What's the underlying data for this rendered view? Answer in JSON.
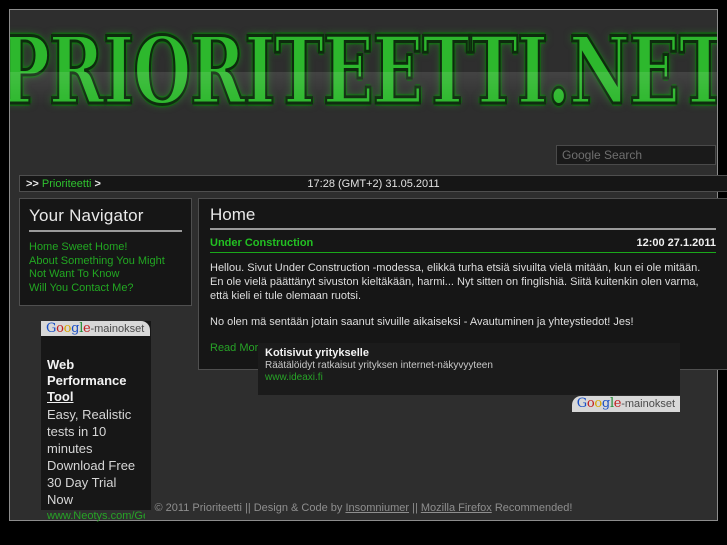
{
  "site": {
    "logo_text": "PRIORITEETTI.NET",
    "accent_green": "#22c022",
    "link_green": "#27a327",
    "background": "#2e2e2e",
    "panel_background": "#161616"
  },
  "search": {
    "placeholder": "Google Search",
    "value": ""
  },
  "breadcrumb": {
    "prefix": ">>",
    "link": "Prioriteetti",
    "suffix": ">"
  },
  "clock": {
    "text": "17:28 (GMT+2) 31.05.2011"
  },
  "sidebar": {
    "title": "Your Navigator",
    "items": [
      {
        "label": "Home Sweet Home!"
      },
      {
        "label": "About Something You Might Not Want To Know"
      },
      {
        "label": "Will You Contact Me?"
      }
    ],
    "ad": {
      "tag_brand": "Google",
      "tag_suffix": "-mainokset",
      "title_line1": "Web Performance",
      "title_line2": "Tool",
      "description": "Easy, Realistic tests in 10 minutes Download Free 30 Day Trial Now",
      "url": "www.Neotys.com/Get..."
    }
  },
  "main": {
    "page_title": "Home",
    "post": {
      "title": "Under Construction",
      "date": "12:00 27.1.2011",
      "paragraph1": "Hellou. Sivut Under Construction -modessa, elikkä turha etsiä sivuilta vielä mitään, kun ei ole mitään. En ole vielä päättänyt sivuston kieltäkään, harmi... Nyt sitten on finglishiä. Siitä kuitenkin olen varma, että kieli ei tule olemaan ruotsi.",
      "paragraph2": "No olen mä sentään jotain saanut sivuille aikaiseksi - Avautuminen ja yhteystiedot! Jes!",
      "read_more": "Read More... Oh, Ya can't. HaHa!"
    },
    "ad": {
      "title": "Kotisivut yritykselle",
      "description": "Räätälöidyt ratkaisut yrityksen internet-näkyvyyteen",
      "url": "www.ideaxi.fi",
      "tag_brand": "Google",
      "tag_suffix": "-mainokset"
    }
  },
  "footer": {
    "copyright": "© 2011 Prioriteetti || Design & Code by ",
    "author_link": "Insomniumer",
    "separator": " || ",
    "browser_link": "Mozilla Firefox",
    "recommended": " Recommended!"
  }
}
